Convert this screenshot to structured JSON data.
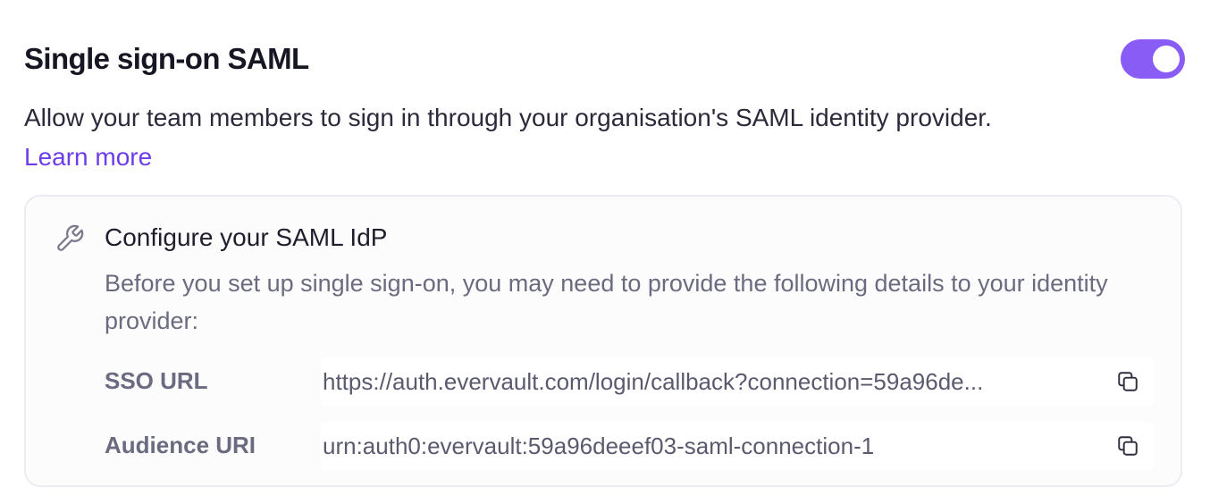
{
  "header": {
    "title": "Single sign-on SAML",
    "toggle_state": "on",
    "accent_color": "#8a5cf6"
  },
  "description": {
    "text": "Allow your team members to sign in through your organisation's SAML identity provider.",
    "learn_more": "Learn more"
  },
  "config_card": {
    "icon": "wrench-icon",
    "title": "Configure your SAML IdP",
    "description": "Before you set up single sign-on, you may need to provide the following details to your identity provider:",
    "rows": [
      {
        "label": "SSO URL",
        "value": "https://auth.evervault.com/login/callback?connection=59a96de...",
        "copy_icon": "copy-icon"
      },
      {
        "label": "Audience URI",
        "value": "urn:auth0:evervault:59a96deeef03-saml-connection-1",
        "copy_icon": "copy-icon"
      }
    ]
  }
}
